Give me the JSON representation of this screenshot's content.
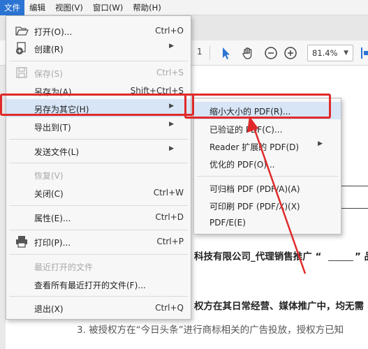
{
  "menubar": {
    "items": [
      "文件",
      "编辑",
      "视图(V)",
      "窗口(W)",
      "帮助(H)"
    ]
  },
  "toolbar": {
    "page_number": "1",
    "zoom": "81.4%"
  },
  "document": {
    "lines": [
      "科技有限公司_代理销售推广 “",
      "” 品",
      "权方在其日常经营、媒体推广中，均无需",
      "3. 被授权方在“今日头条”进行商标相关的广告投放，授权方已知"
    ]
  },
  "file_menu": {
    "items": [
      {
        "label": "打开(O)...",
        "shortcut": "Ctrl+O",
        "icon": "folder-open-icon"
      },
      {
        "label": "创建(R)",
        "submenu": true,
        "icon": "create-pdf-icon"
      },
      {
        "label": "保存(S)",
        "shortcut": "Ctrl+S",
        "disabled": true,
        "icon": "save-icon"
      },
      {
        "label": "另存为(A)...",
        "shortcut": "Shift+Ctrl+S"
      },
      {
        "label": "另存为其它(H)",
        "submenu": true,
        "highlight": true
      },
      {
        "label": "导出到(T)",
        "submenu": true
      },
      {
        "label": "发送文件(L)",
        "submenu": true
      },
      {
        "label": "恢复(V)",
        "disabled": true
      },
      {
        "label": "关闭(C)",
        "shortcut": "Ctrl+W"
      },
      {
        "label": "属性(E)...",
        "shortcut": "Ctrl+D"
      },
      {
        "label": "打印(P)...",
        "shortcut": "Ctrl+P",
        "icon": "print-icon"
      },
      {
        "label": "最近打开的文件",
        "disabled": true
      },
      {
        "label": "查看所有最近打开的文件(F)..."
      },
      {
        "label": "退出(X)",
        "shortcut": "Ctrl+Q"
      }
    ]
  },
  "save_other_submenu": {
    "items": [
      {
        "label": "缩小大小的 PDF(R)...",
        "highlight": true
      },
      {
        "label": "已验证的 PDF(C)..."
      },
      {
        "label": "Reader 扩展的 PDF(D)",
        "submenu": true
      },
      {
        "label": "优化的 PDF(O)..."
      },
      {
        "label": "可归档 PDF (PDF/A)(A)"
      },
      {
        "label": "可印刷 PDF (PDF/X)(X)"
      },
      {
        "label": "PDF/E(E)"
      }
    ]
  },
  "colors": {
    "accent": "#2b74d3",
    "highlight": "#d7e5f7",
    "annotation_red": "#e02a2a"
  }
}
